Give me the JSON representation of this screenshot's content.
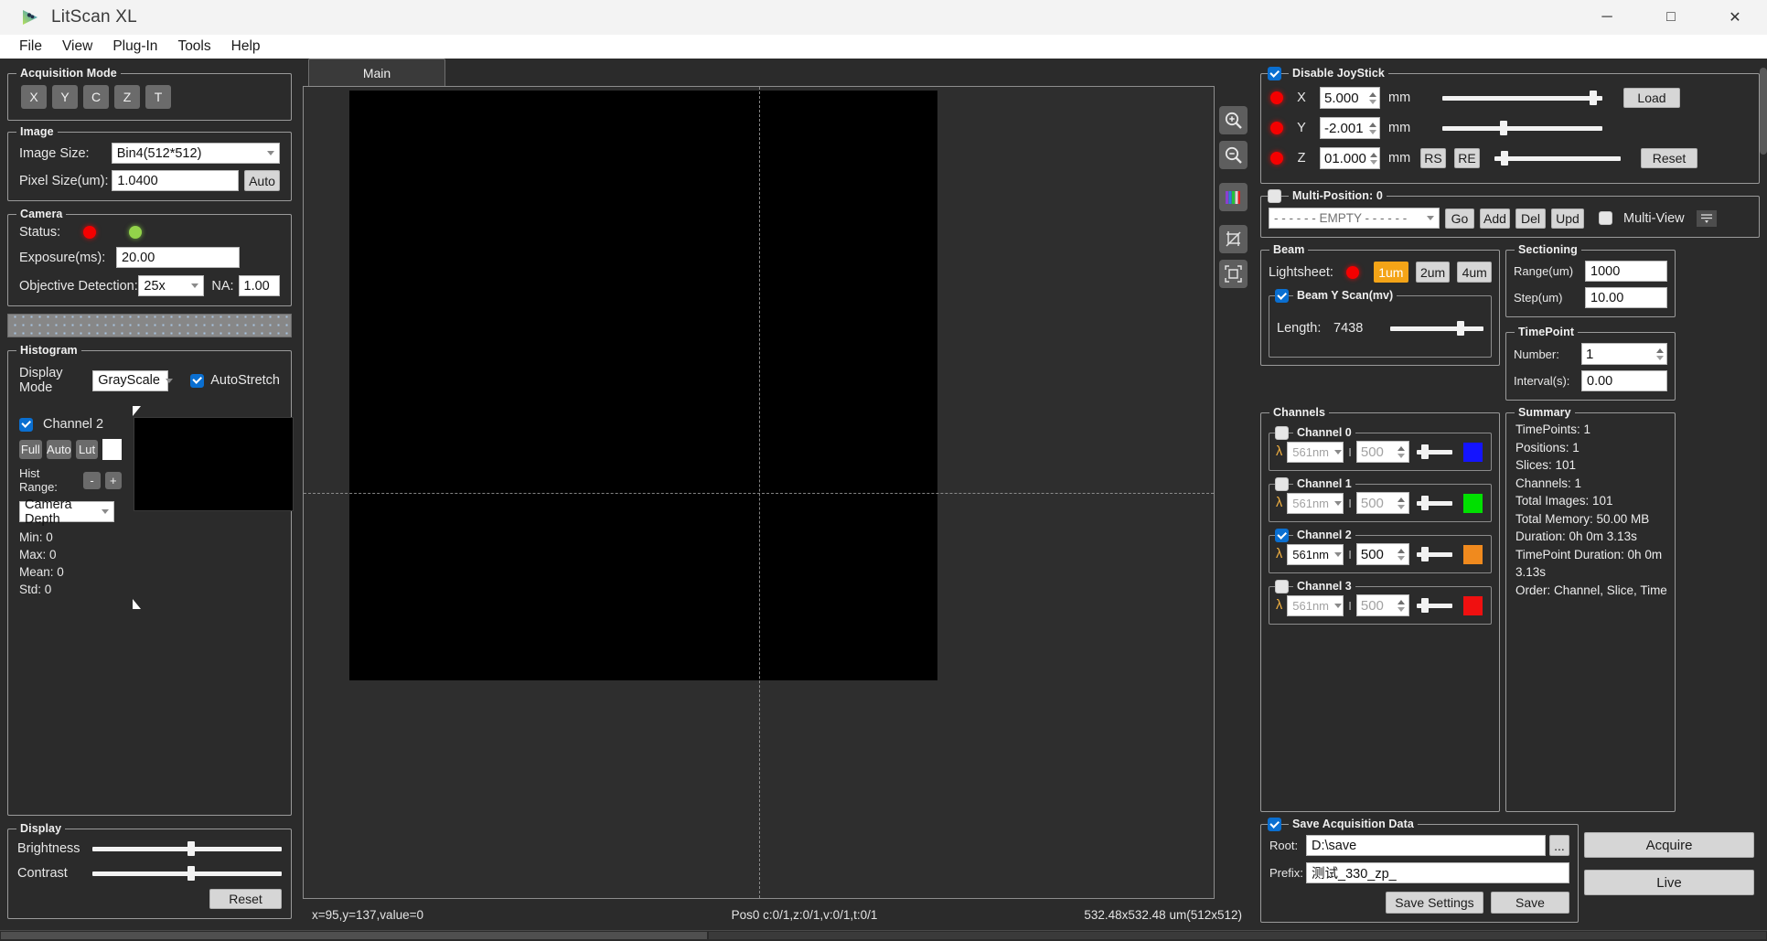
{
  "window": {
    "title": "LitScan XL",
    "minimize": "─",
    "maximize": "□",
    "close": "✕"
  },
  "menu": [
    "File",
    "View",
    "Plug-In",
    "Tools",
    "Help"
  ],
  "acquisition_mode": {
    "title": "Acquisition Mode",
    "buttons": [
      "X",
      "Y",
      "C",
      "Z",
      "T"
    ]
  },
  "image": {
    "title": "Image",
    "size_label": "Image Size:",
    "size_value": "Bin4(512*512)",
    "pixel_label": "Pixel Size(um):",
    "pixel_value": "1.0400",
    "auto_button": "Auto"
  },
  "camera": {
    "title": "Camera",
    "status_label": "Status:",
    "exposure_label": "Exposure(ms):",
    "exposure_value": "20.00",
    "objective_label": "Objective  Detection:",
    "objective_value": "25x",
    "na_label": "NA:",
    "na_value": "1.00"
  },
  "histogram": {
    "title": "Histogram",
    "display_mode_label": "Display Mode",
    "display_mode_value": "GrayScale",
    "autostretch_label": "AutoStretch",
    "autostretch_checked": true,
    "channel_label": "Channel 2",
    "channel_checked": true,
    "buttons": [
      "Full",
      "Auto",
      "Lut"
    ],
    "hist_range_label": "Hist Range:",
    "minus": "-",
    "plus": "+",
    "depth_value": "Camera Depth",
    "stats": [
      "Min: 0",
      "Max: 0",
      "Mean: 0",
      "Std: 0"
    ]
  },
  "display": {
    "title": "Display",
    "brightness_label": "Brightness",
    "contrast_label": "Contrast",
    "reset_button": "Reset"
  },
  "center": {
    "tab_label": "Main",
    "tools": [
      "zoom-in-icon",
      "zoom-out-icon",
      "color-channels-icon",
      "crop-icon",
      "fit-icon"
    ],
    "status_left": "x=95,y=137,value=0",
    "status_mid": "Pos0 c:0/1,z:0/1,v:0/1,t:0/1",
    "status_right": "532.48x532.48 um(512x512)"
  },
  "joystick": {
    "title": "Disable JoyStick",
    "checked": true,
    "axes": [
      {
        "name": "X",
        "value": "5.000",
        "unit": "mm",
        "slider_pct": 92
      },
      {
        "name": "Y",
        "value": "-2.001",
        "unit": "mm",
        "slider_pct": 36
      },
      {
        "name": "Z",
        "value": "01.000",
        "unit": "mm",
        "slider_pct": 6
      }
    ],
    "load_button": "Load",
    "reset_button": "Reset",
    "rs_button": "RS",
    "re_button": "RE"
  },
  "multiposition": {
    "title": "Multi-Position: 0",
    "checked": false,
    "combo_value": "- - - - - -  EMPTY - - - - - -",
    "buttons": [
      "Go",
      "Add",
      "Del",
      "Upd"
    ],
    "multiview_label": "Multi-View",
    "multiview_checked": false
  },
  "beam": {
    "title": "Beam",
    "lightsheet_label": "Lightsheet:",
    "options": [
      "1um",
      "2um",
      "4um"
    ],
    "selected": "1um",
    "scan_title": "Beam Y Scan(mv)",
    "scan_checked": true,
    "length_label": "Length:",
    "length_value": "7438",
    "length_pct": 72
  },
  "sectioning": {
    "title": "Sectioning",
    "range_label": "Range(um)",
    "range_value": "1000",
    "step_label": "Step(um)",
    "step_value": "10.00"
  },
  "timepoint": {
    "title": "TimePoint",
    "number_label": "Number:",
    "number_value": "1",
    "interval_label": "Interval(s):",
    "interval_value": "0.00"
  },
  "channels": {
    "title": "Channels",
    "lambda_symbol": "λ",
    "intensity_symbol": "I",
    "items": [
      {
        "title": "Channel 0",
        "checked": false,
        "wavelength": "561nm",
        "intensity": "500",
        "color": "#1414ff",
        "slider_pct": 12
      },
      {
        "title": "Channel 1",
        "checked": false,
        "wavelength": "561nm",
        "intensity": "500",
        "color": "#00e000",
        "slider_pct": 12
      },
      {
        "title": "Channel 2",
        "checked": true,
        "wavelength": "561nm",
        "intensity": "500",
        "color": "#f08a1e",
        "slider_pct": 12
      },
      {
        "title": "Channel 3",
        "checked": false,
        "wavelength": "561nm",
        "intensity": "500",
        "color": "#f01010",
        "slider_pct": 12
      }
    ]
  },
  "summary": {
    "title": "Summary",
    "lines": [
      "TimePoints: 1",
      "Positions: 1",
      "Slices: 101",
      "Channels: 1",
      "Total Images: 101",
      "Total Memory: 50.00 MB",
      "Duration: 0h 0m 3.13s",
      "TimePoint Duration: 0h 0m 3.13s",
      "Order: Channel, Slice, Time"
    ]
  },
  "save": {
    "title": "Save Acquisition Data",
    "checked": true,
    "root_label": "Root:",
    "root_value": "D:\\save",
    "browse_button": "...",
    "prefix_label": "Prefix:",
    "prefix_value": "测试_330_zp_",
    "save_settings_button": "Save Settings",
    "save_button": "Save"
  },
  "actions": {
    "acquire_button": "Acquire",
    "live_button": "Live"
  }
}
